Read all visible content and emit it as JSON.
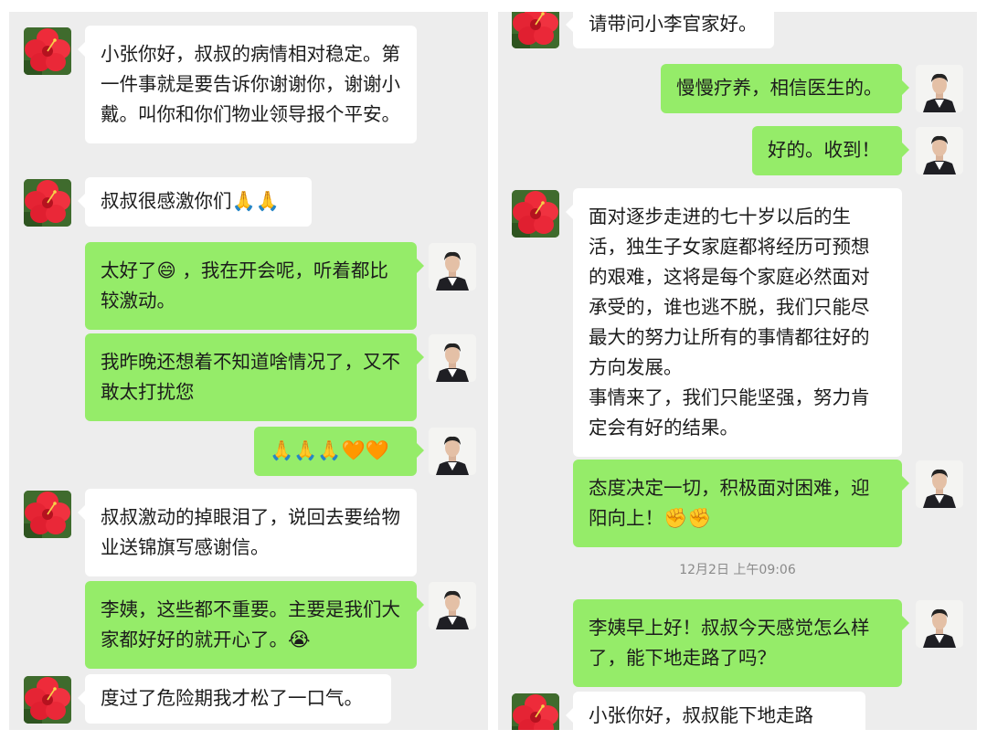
{
  "left_panel": {
    "messages": [
      {
        "side": "in",
        "text": "小张你好，叔叔的病情相对稳定。第一件事就是要告诉你谢谢你，谢谢小戴。叫你和你们物业领导报个平安。"
      },
      {
        "side": "in",
        "text": "叔叔很感激你们",
        "emoji": "🙏🙏"
      },
      {
        "side": "out",
        "text": "太好了😄 ，我在开会呢，听着都比较激动。"
      },
      {
        "side": "out",
        "text": "我昨晚还想着不知道啥情况了，又不敢太打扰您"
      },
      {
        "side": "out",
        "text": "",
        "emoji": "🙏🙏🙏🧡🧡"
      },
      {
        "side": "in",
        "text": "叔叔激动的掉眼泪了，说回去要给物业送锦旗写感谢信。"
      },
      {
        "side": "out",
        "text": "李姨，这些都不重要。主要是我们大家都好好的就开心了。",
        "emoji": "😭"
      },
      {
        "side": "in",
        "text": "度过了危险期我才松了一口气。"
      }
    ]
  },
  "right_panel": {
    "messages": [
      {
        "side": "in",
        "text": "请带问小李官家好。"
      },
      {
        "side": "out",
        "text": "慢慢疗养，相信医生的。"
      },
      {
        "side": "out",
        "text": "好的。收到！"
      },
      {
        "side": "in",
        "text": "面对逐步走进的七十岁以后的生活，独生子女家庭都将经历可预想的艰难，这将是每个家庭必然面对承受的，谁也逃不脱，我们只能尽最大的努力让所有的事情都往好的方向发展。"
      },
      {
        "side": "in",
        "text": "事情来了，我们只能坚强，努力肯定会有好的结果。"
      },
      {
        "side": "out",
        "text": "态度决定一切，积极面对困难，迎阳向上！",
        "emoji": "✊✊"
      },
      {
        "side": "time",
        "text": "12月2日 上午09:06"
      },
      {
        "side": "out",
        "text": "李姨早上好！叔叔今天感觉怎么样了，能下地走路了吗？"
      },
      {
        "side": "in",
        "text": "小张你好，叔叔能下地走路了。"
      }
    ]
  },
  "icons": {
    "contact_avatar": "hibiscus-flower-avatar",
    "self_avatar": "man-portrait-avatar"
  },
  "colors": {
    "background": "#ededed",
    "incoming_bubble": "#ffffff",
    "outgoing_bubble": "#95ec69"
  }
}
